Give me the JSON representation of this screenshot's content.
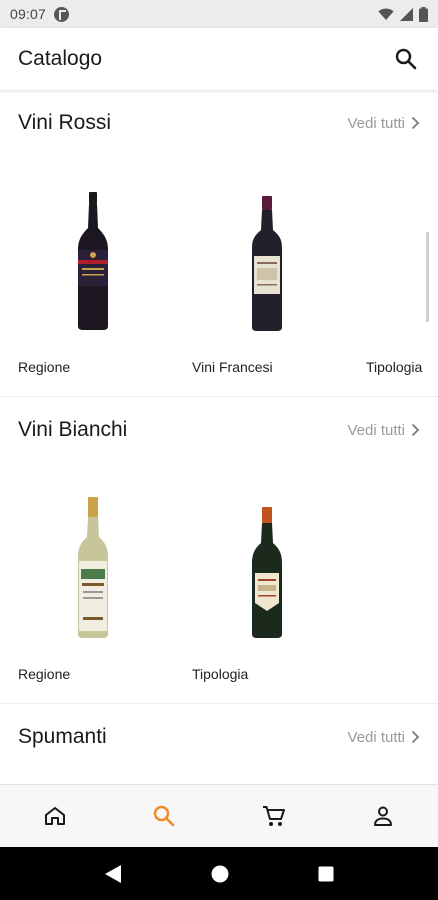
{
  "status_bar": {
    "time": "09:07"
  },
  "app_bar": {
    "title": "Catalogo"
  },
  "colors": {
    "accent": "#f08a24",
    "text": "#1a1a1a",
    "muted": "#9a9a9a"
  },
  "sections": [
    {
      "title": "Vini Rossi",
      "see_all": "Vedi tutti",
      "items": [
        {
          "label": "Regione"
        },
        {
          "label": "Vini Francesi"
        },
        {
          "label": "Tipologia"
        }
      ]
    },
    {
      "title": "Vini Bianchi",
      "see_all": "Vedi tutti",
      "items": [
        {
          "label": "Regione"
        },
        {
          "label": "Tipologia"
        }
      ]
    },
    {
      "title": "Spumanti",
      "see_all": "Vedi tutti",
      "items": []
    }
  ],
  "bottom_nav": [
    {
      "icon": "home-icon",
      "active": false
    },
    {
      "icon": "search-icon",
      "active": true
    },
    {
      "icon": "cart-icon",
      "active": false
    },
    {
      "icon": "profile-icon",
      "active": false
    }
  ],
  "system_nav": [
    "back-icon",
    "home-circle-icon",
    "recents-icon"
  ]
}
